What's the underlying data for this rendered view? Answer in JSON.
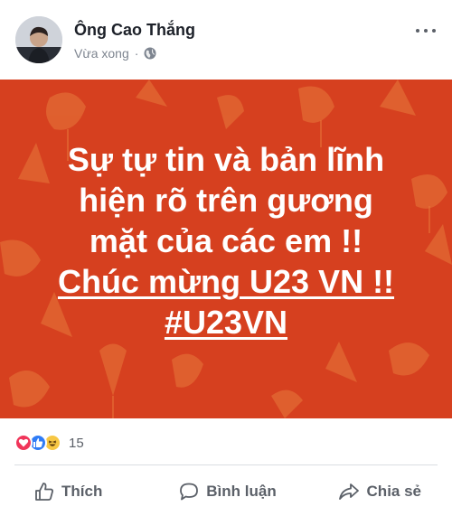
{
  "post": {
    "author": "Ông Cao Thắng",
    "time": "Vừa xong",
    "separator": "·",
    "audience_icon": "globe-icon",
    "menu_icon": "more-options-icon"
  },
  "banner": {
    "background_color": "#d6401f",
    "text_color": "#ffffff",
    "lines": [
      "Sự tự tin và bản lĩnh",
      "hiện rõ trên gương",
      "mặt của các em !!",
      "Chúc mừng U23 VN !!",
      "#U23VN"
    ]
  },
  "reactions": {
    "icons": [
      "love-reaction-icon",
      "like-reaction-icon",
      "haha-reaction-icon"
    ],
    "count": "15"
  },
  "actions": {
    "like": "Thích",
    "comment": "Bình luận",
    "share": "Chia sẻ"
  }
}
